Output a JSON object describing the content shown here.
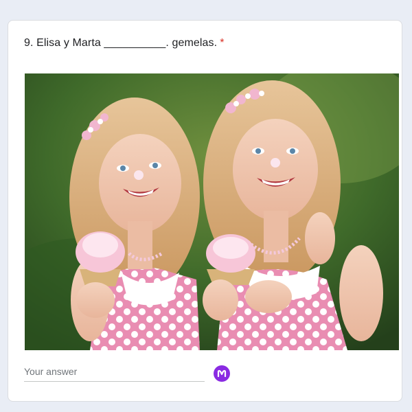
{
  "question": {
    "number": "9.",
    "text": "Elisa y Marta __________. gemelas.",
    "required_mark": "*"
  },
  "image": {
    "alt": "Two twin girls with flower crowns holding pink cupcakes"
  },
  "answer": {
    "placeholder": "Your answer",
    "value": ""
  },
  "extension": {
    "icon": "m-logo-icon",
    "color": "#8a2be2"
  },
  "colors": {
    "required": "#d93025",
    "background": "#e9edf5"
  }
}
